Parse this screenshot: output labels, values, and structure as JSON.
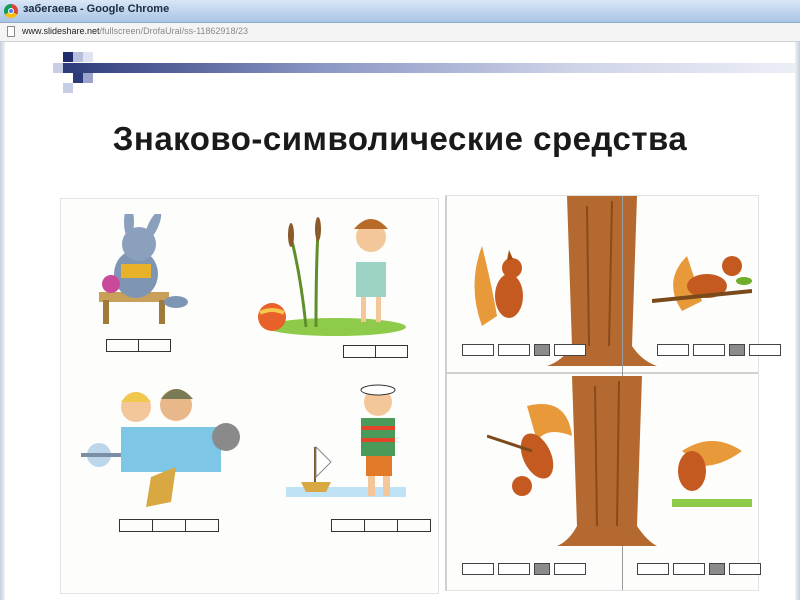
{
  "window": {
    "title": "забегаева - Google Chrome",
    "app_icon": "chrome-icon"
  },
  "addressbar": {
    "url_host": "www.slideshare.net",
    "url_path": "/fullscreen/DrofaUral/ss-11862918/23",
    "page_icon": "page-icon"
  },
  "slide": {
    "title": "Знаково-символические средства",
    "accent_color": "#2c3a7a",
    "illustrations": {
      "left": [
        "rabbit-on-bench",
        "girl-with-ball",
        "children-in-car",
        "sailor-boy-with-boat"
      ],
      "right": [
        "squirrels-by-tree-top",
        "squirrels-by-tree-bottom"
      ]
    }
  }
}
